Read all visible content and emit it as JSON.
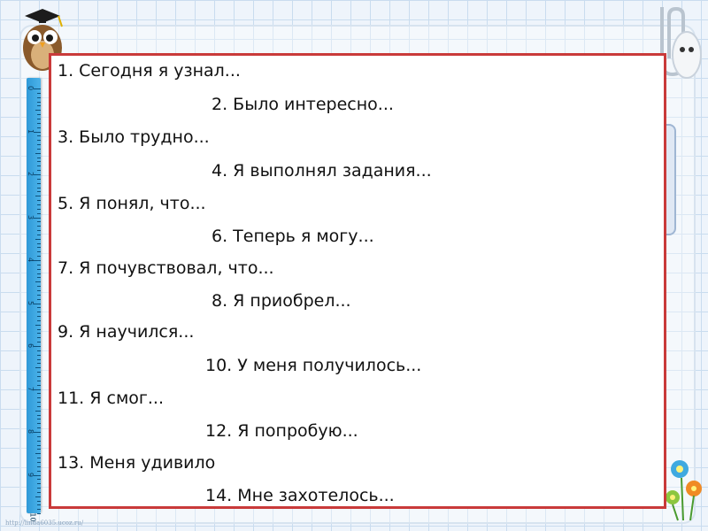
{
  "slide": {
    "items": [
      {
        "text": "1. Сегодня я узнал..."
      },
      {
        "text": "2. Было интересно..."
      },
      {
        "text": "3. Было трудно..."
      },
      {
        "text": "4. Я выполнял задания..."
      },
      {
        "text": "5. Я понял, что..."
      },
      {
        "text": "6. Теперь я могу..."
      },
      {
        "text": "7. Я почувствовал, что..."
      },
      {
        "text": "8. Я приобрел..."
      },
      {
        "text": "9. Я научился..."
      },
      {
        "text": "10. У меня получилось..."
      },
      {
        "text": "11. Я смог..."
      },
      {
        "text": "12. Я попробую..."
      },
      {
        "text": "13. Меня удивило"
      },
      {
        "text": "14. Мне захотелось..."
      }
    ]
  },
  "ruler": {
    "numbers": [
      "0",
      "1",
      "2",
      "3",
      "4",
      "5",
      "6",
      "7",
      "8",
      "9",
      "10"
    ]
  },
  "footer": {
    "url": "http://linda6035.ucoz.ru/"
  },
  "colors": {
    "box_border": "#c93a3a",
    "grid_line": "#c9dcef",
    "ruler": "#2f9ad8"
  }
}
